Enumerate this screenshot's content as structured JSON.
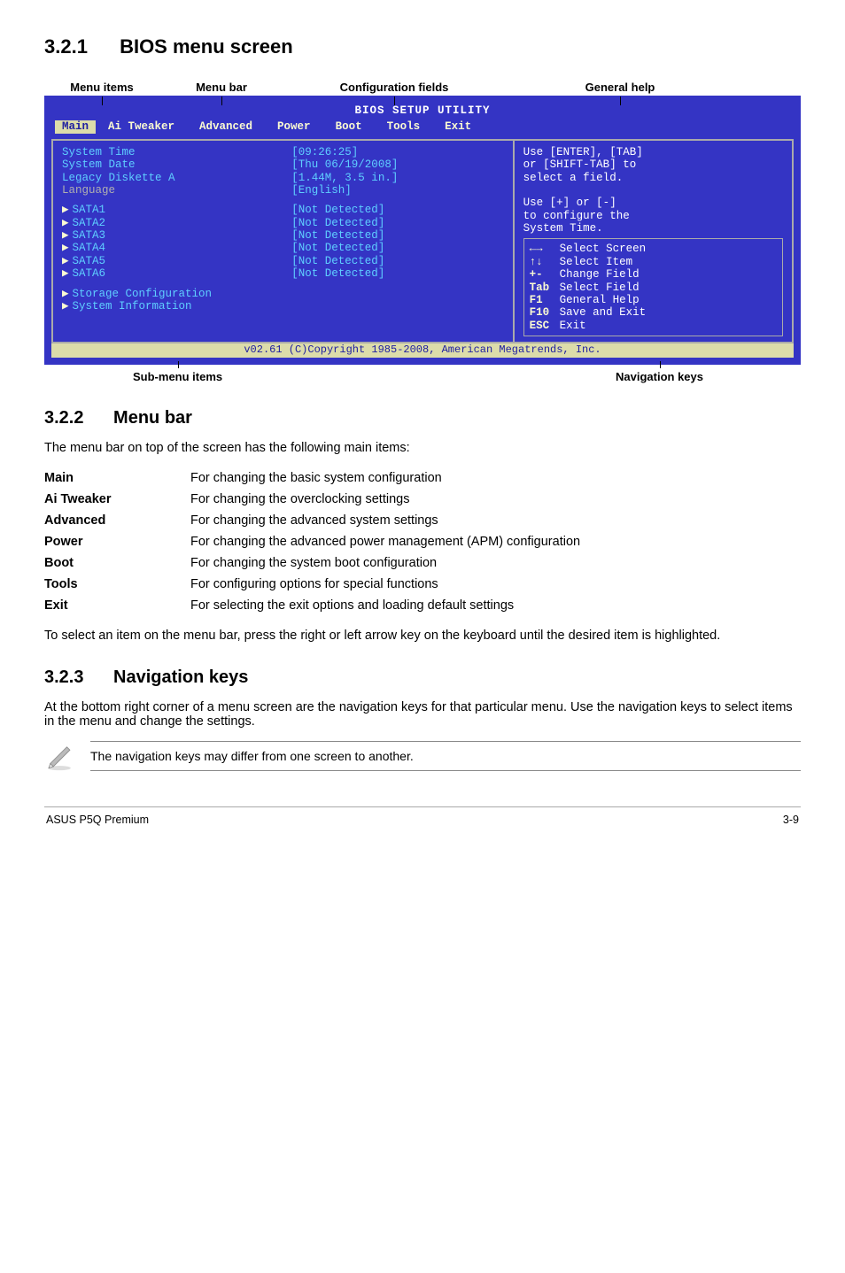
{
  "sections": {
    "s1_num": "3.2.1",
    "s1_title": "BIOS menu screen",
    "s2_num": "3.2.2",
    "s2_title": "Menu bar",
    "s2_intro": "The menu bar on top of the screen has the following main items:",
    "s2_outro": "To select an item on the menu bar, press the right or left arrow key on the keyboard until the desired item is highlighted.",
    "s3_num": "3.2.3",
    "s3_title": "Navigation keys",
    "s3_text": "At the bottom right corner of a menu screen are the navigation keys for that particular menu. Use the navigation keys to select items in the menu and change the settings.",
    "note": "The navigation keys may differ from one screen to another."
  },
  "header_labels": {
    "l1": "Menu items",
    "l2": "Menu bar",
    "l3": "Configuration fields",
    "l4": "General help"
  },
  "bottom_labels": {
    "left": "Sub-menu items",
    "right": "Navigation keys"
  },
  "bios": {
    "title": "BIOS SETUP UTILITY",
    "tabs": [
      "Main",
      "Ai Tweaker",
      "Advanced",
      "Power",
      "Boot",
      "Tools",
      "Exit"
    ],
    "left_rows": [
      {
        "k": "System Time",
        "v": "[09:26:25]",
        "arrow": false
      },
      {
        "k": "System Date",
        "v": "[Thu 06/19/2008]",
        "arrow": false
      },
      {
        "k": "Legacy Diskette A",
        "v": "[1.44M, 3.5 in.]",
        "arrow": false
      },
      {
        "k": "Language",
        "v": "[English]",
        "arrow": false,
        "gray": true
      }
    ],
    "sata": [
      {
        "k": "SATA1",
        "v": "[Not Detected]"
      },
      {
        "k": "SATA2",
        "v": "[Not Detected]"
      },
      {
        "k": "SATA3",
        "v": "[Not Detected]"
      },
      {
        "k": "SATA4",
        "v": "[Not Detected]"
      },
      {
        "k": "SATA5",
        "v": "[Not Detected]"
      },
      {
        "k": "SATA6",
        "v": "[Not Detected]"
      }
    ],
    "submenus": [
      "Storage Configuration",
      "System Information"
    ],
    "help_top": [
      "Use [ENTER], [TAB]",
      "or [SHIFT-TAB] to",
      "select a field.",
      "",
      "Use [+] or [-]",
      "to configure the",
      "System Time."
    ],
    "help_keys": [
      {
        "kk": "←→",
        "kd": "Select Screen"
      },
      {
        "kk": "↑↓",
        "kd": "Select Item"
      },
      {
        "kk": "+-",
        "kd": "Change Field"
      },
      {
        "kk": "Tab",
        "kd": "Select Field"
      },
      {
        "kk": "F1",
        "kd": "General Help"
      },
      {
        "kk": "F10",
        "kd": "Save and Exit"
      },
      {
        "kk": "ESC",
        "kd": "Exit"
      }
    ],
    "footer": "v02.61 (C)Copyright 1985-2008, American Megatrends, Inc."
  },
  "menu_items": [
    {
      "key": "Main",
      "desc": "For changing the basic system configuration"
    },
    {
      "key": "Ai Tweaker",
      "desc": "For changing the overclocking settings"
    },
    {
      "key": "Advanced",
      "desc": "For changing the advanced system settings"
    },
    {
      "key": "Power",
      "desc": "For changing the advanced power management (APM) configuration"
    },
    {
      "key": "Boot",
      "desc": "For changing the system boot configuration"
    },
    {
      "key": "Tools",
      "desc": "For configuring options for special functions"
    },
    {
      "key": "Exit",
      "desc": "For selecting the exit options and loading default settings"
    }
  ],
  "page_footer": {
    "left": "ASUS P5Q Premium",
    "right": "3-9"
  }
}
